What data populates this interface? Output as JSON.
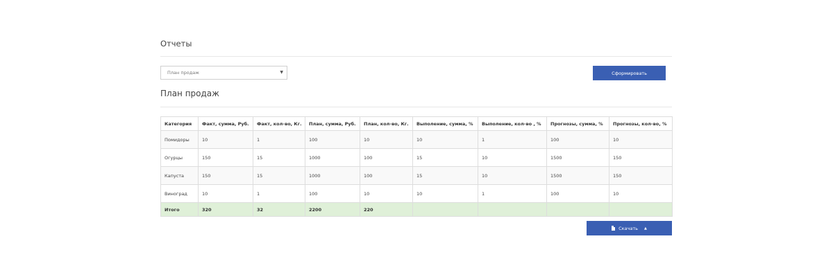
{
  "reports": {
    "title": "Отчеты",
    "report_select": {
      "selected": "План продаж",
      "caret": "▼"
    },
    "generate_button": "Сформировать"
  },
  "plan": {
    "title": "План продаж",
    "table": {
      "headers": [
        "Категория",
        "Факт, сумма, Руб.",
        "Факт, кол-во, Кг.",
        "План, сумма, Руб.",
        "План, кол-во, Кг.",
        "Выполение, сумма, %",
        "Выполение, кол-во , %",
        "Прогнозы, сумма, %",
        "Прогнозы, кол-во, %"
      ],
      "rows": [
        [
          "Помидоры",
          "10",
          "1",
          "100",
          "10",
          "10",
          "1",
          "100",
          "10"
        ],
        [
          "Огурцы",
          "150",
          "15",
          "1000",
          "100",
          "15",
          "10",
          "1500",
          "150"
        ],
        [
          "Капуста",
          "150",
          "15",
          "1000",
          "100",
          "15",
          "10",
          "1500",
          "150"
        ],
        [
          "Виноград",
          "10",
          "1",
          "100",
          "10",
          "10",
          "1",
          "100",
          "10"
        ]
      ],
      "total": [
        "Итого",
        "320",
        "32",
        "2200",
        "220",
        "",
        "",
        "",
        ""
      ]
    },
    "download_button": {
      "label": "Скачать",
      "icon": "file-icon",
      "caret": "▲"
    }
  },
  "colors": {
    "primary": "#3a5fb3",
    "total_row": "#dff0d8",
    "border": "#dddddd"
  }
}
